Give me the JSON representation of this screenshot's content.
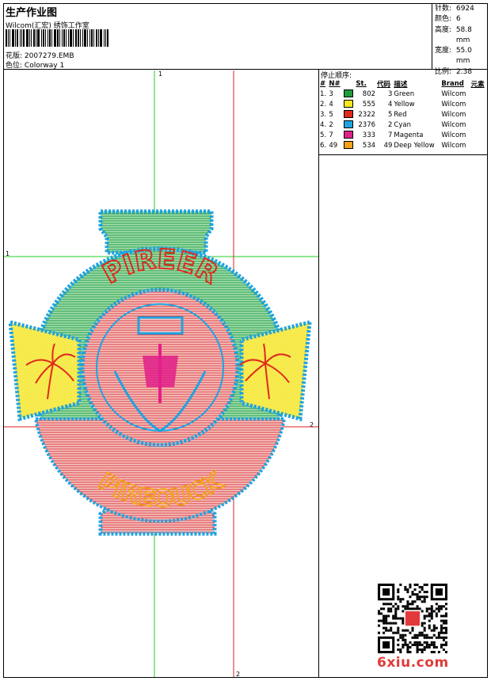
{
  "header": {
    "title": "生产作业图",
    "subtitle": "Wilcom(汇宏) 绣饰工作室",
    "file_label": "花版:",
    "file_value": "2007279.EMB",
    "colorway_label": "色位:",
    "colorway_value": "Colorway 1"
  },
  "stats": [
    {
      "label": "针数:",
      "value": "6924"
    },
    {
      "label": "颜色:",
      "value": "6"
    },
    {
      "label": "高度:",
      "value": "58.8 mm"
    },
    {
      "label": "宽度:",
      "value": "55.0 mm"
    },
    {
      "label": "比例:",
      "value": "2.38"
    }
  ],
  "stop_sequence": {
    "title": "停止顺序:",
    "columns": [
      "#",
      "N#",
      "St.",
      "代码",
      "描述",
      "Brand",
      "元素"
    ],
    "rows": [
      {
        "idx": "1.",
        "n": "3",
        "color": "#1f9a3c",
        "st": "802",
        "code": "3",
        "desc": "Green",
        "brand": "Wilcom"
      },
      {
        "idx": "2.",
        "n": "4",
        "color": "#f4e81c",
        "st": "555",
        "code": "4",
        "desc": "Yellow",
        "brand": "Wilcom"
      },
      {
        "idx": "3.",
        "n": "5",
        "color": "#e02a1c",
        "st": "2322",
        "code": "5",
        "desc": "Red",
        "brand": "Wilcom"
      },
      {
        "idx": "4.",
        "n": "2",
        "color": "#1ea3e0",
        "st": "2376",
        "code": "2",
        "desc": "Cyan",
        "brand": "Wilcom"
      },
      {
        "idx": "5.",
        "n": "7",
        "color": "#e0208a",
        "st": "333",
        "code": "7",
        "desc": "Magenta",
        "brand": "Wilcom"
      },
      {
        "idx": "6.",
        "n": "49",
        "color": "#f4a21c",
        "st": "534",
        "code": "49",
        "desc": "Deep Yellow",
        "brand": "Wilcom"
      }
    ]
  },
  "canvas": {
    "guides": {
      "top": "1",
      "left": "1",
      "right": "2",
      "bottom": "2"
    },
    "design_text_top": "PIREER",
    "design_text_bottom": "PIREOUCK"
  },
  "watermark": {
    "logo": "6xiu.com"
  }
}
